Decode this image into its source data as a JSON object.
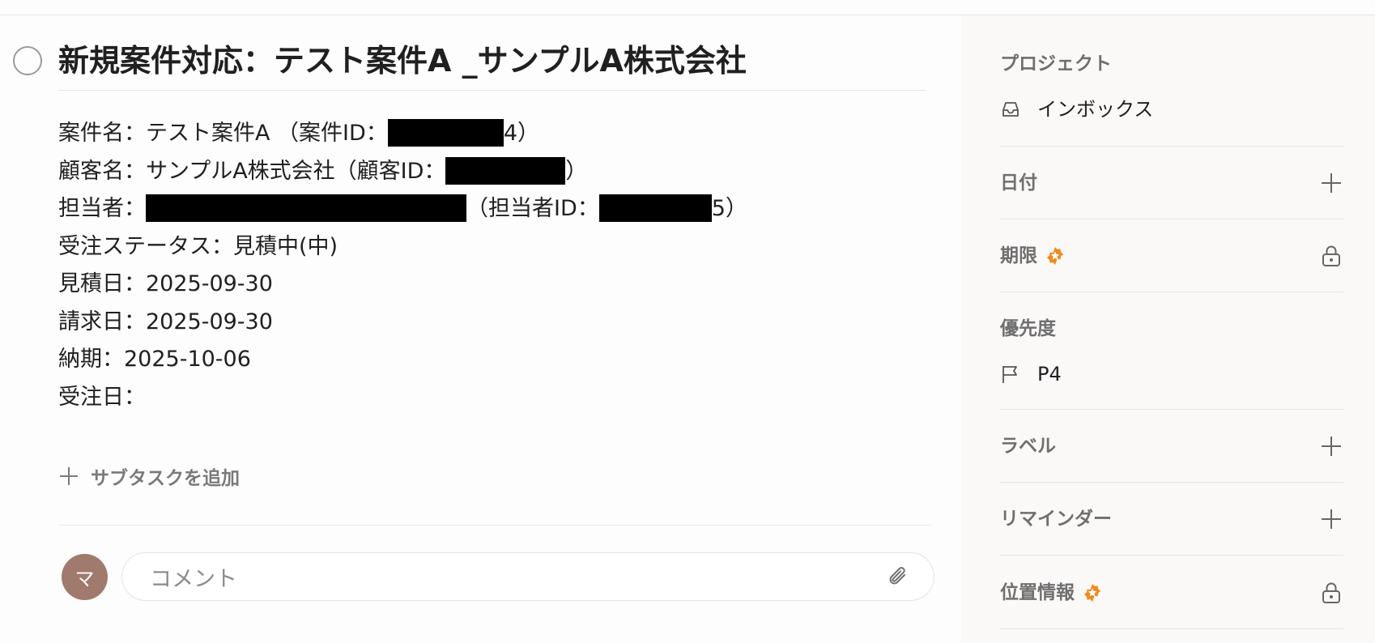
{
  "task": {
    "title": "新規案件対応：テスト案件A _サンプルA株式会社",
    "description": {
      "line1_pre": "案件名：テスト案件A （案件ID：",
      "line1_post": "4）",
      "line2_pre": "顧客名：サンプルA株式会社（顧客ID：",
      "line2_post": "）",
      "line3_pre": "担当者：",
      "line3_mid": "（担当者ID：",
      "line3_post": "5）",
      "line4": "受注ステータス：見積中(中)",
      "line5": "見積日：2025-09-30",
      "line6": "請求日：2025-09-30",
      "line7": "納期：2025-10-06",
      "line8": "受注日："
    },
    "add_subtask_label": "サブタスクを追加"
  },
  "comment": {
    "avatar_initial": "マ",
    "avatar_color": "#a07a6c",
    "placeholder": "コメント"
  },
  "sidebar": {
    "project_label": "プロジェクト",
    "project_value": "インボックス",
    "date_label": "日付",
    "deadline_label": "期限",
    "priority_label": "優先度",
    "priority_value": "P4",
    "labels_label": "ラベル",
    "reminder_label": "リマインダー",
    "location_label": "位置情報"
  },
  "colors": {
    "pro_badge": "#f08a1c",
    "sidebar_bg": "#fbf8f8"
  },
  "icons": {
    "project": "inbox-icon",
    "priority": "flag-icon",
    "add": "plus-icon",
    "locked": "lock-icon",
    "pro": "pro-badge-icon",
    "attach": "paperclip-icon"
  }
}
